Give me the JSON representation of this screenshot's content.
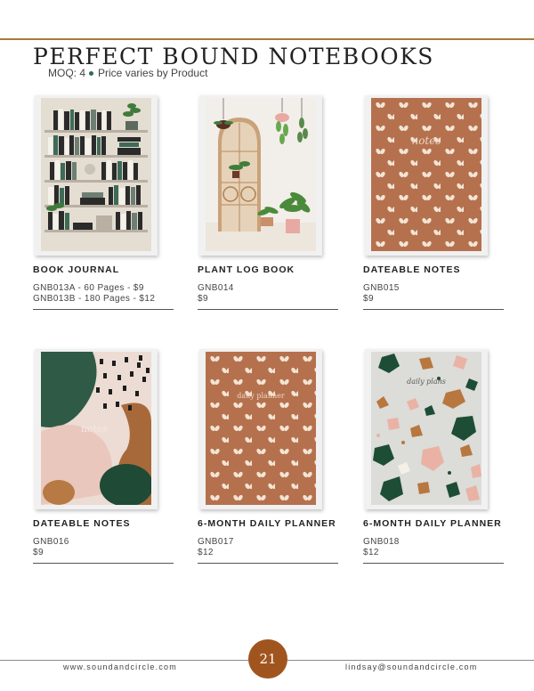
{
  "page": {
    "title": "PERFECT BOUND NOTEBOOKS",
    "moq": "MOQ: 4",
    "price_note": "Price varies by Product",
    "page_number": "21",
    "footer_left": "www.soundandcircle.com",
    "footer_right": "lindsay@soundandcircle.com",
    "accent_color": "#a97a3a",
    "page_badge_color": "#a0551f"
  },
  "products": [
    {
      "name": "BOOK JOURNAL",
      "line1": "GNB013A - 60 Pages - $9",
      "line2": "GNB013B - 180 Pages - $12",
      "cover": "bookshelf-illustration"
    },
    {
      "name": "PLANT LOG BOOK",
      "line1": "GNB014",
      "line2": "$9",
      "cover": "plants-and-cabinet-illustration"
    },
    {
      "name": "DATEABLE NOTES",
      "line1": "GNB015",
      "line2": "$9",
      "cover_text": "notes",
      "cover": "terracotta-leaf-pattern"
    },
    {
      "name": "DATEABLE NOTES",
      "line1": "GNB016",
      "line2": "$9",
      "cover_text": "notes",
      "cover": "abstract-green-pink-brush"
    },
    {
      "name": "6-MONTH DAILY PLANNER",
      "line1": "GNB017",
      "line2": "$12",
      "cover_text": "daily planner",
      "cover": "terracotta-leaf-pattern"
    },
    {
      "name": "6-MONTH DAILY PLANNER",
      "line1": "GNB018",
      "line2": "$12",
      "cover_text": "daily plans",
      "cover": "terrazzo-pattern"
    }
  ]
}
